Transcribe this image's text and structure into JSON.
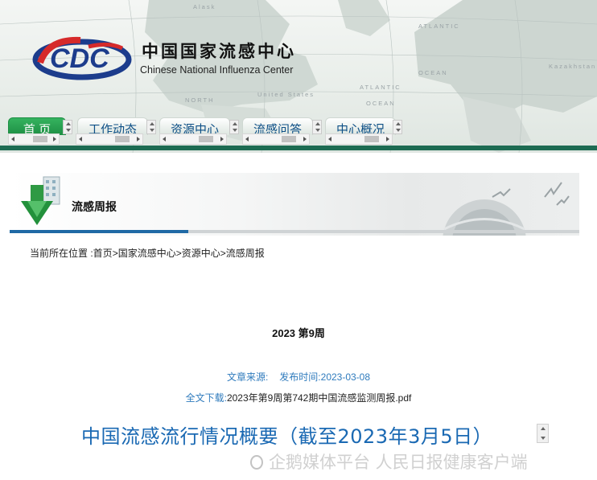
{
  "header": {
    "site_title_cn": "中国国家流感中心",
    "site_title_en": "Chinese National Influenza Center",
    "map_labels": [
      "Alask",
      "NORTH",
      "United States",
      "ATLANTIC",
      "OCEAN",
      "Kazakhstan",
      "OCEAN",
      "ATLANTIC"
    ]
  },
  "nav": {
    "tabs": [
      {
        "label": "首 页"
      },
      {
        "label": "工作动态"
      },
      {
        "label": "资源中心"
      },
      {
        "label": "流感问答"
      },
      {
        "label": "中心概况"
      }
    ]
  },
  "section": {
    "title": "流感周报"
  },
  "breadcrumb": {
    "prefix": "当前所在位置 :",
    "items": [
      "首页",
      "国家流感中心",
      "资源中心",
      "流感周报"
    ],
    "separator": ">"
  },
  "article": {
    "period": "2023 第9周",
    "source_label": "文章来源:",
    "date_label": "发布时间:",
    "date_value": "2023-03-08",
    "download_label": "全文下载:",
    "download_file": "2023年第9周第742期中国流感监测周报.pdf",
    "headline": "中国流感流行情况概要（截至2023年3月5日）"
  },
  "watermark": {
    "text": "企鹅媒体平台 人民日报健康客户端"
  },
  "colors": {
    "nav_green": "#1e8f44",
    "link_blue": "#2f7bbd",
    "headline_blue": "#1a69b3",
    "bar_green": "#1d6b52"
  }
}
